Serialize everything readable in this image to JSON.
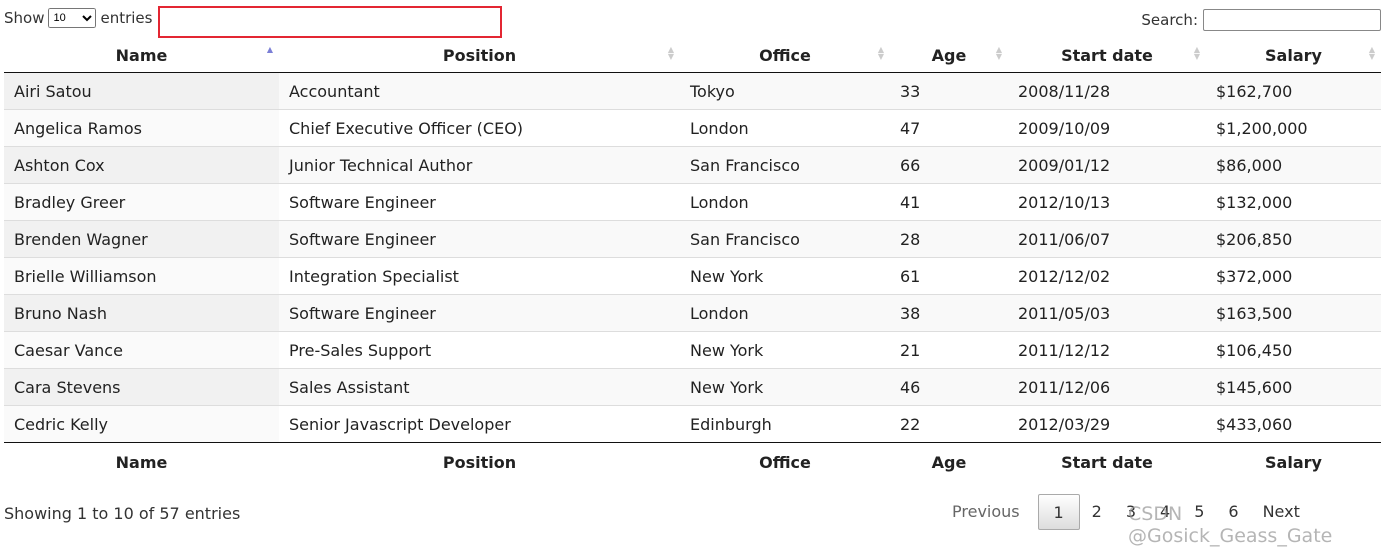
{
  "length": {
    "label_before": "Show",
    "value": "10",
    "label_after": "entries"
  },
  "search": {
    "label": "Search:",
    "value": ""
  },
  "columns": [
    "Name",
    "Position",
    "Office",
    "Age",
    "Start date",
    "Salary"
  ],
  "rows": [
    [
      "Airi Satou",
      "Accountant",
      "Tokyo",
      "33",
      "2008/11/28",
      "$162,700"
    ],
    [
      "Angelica Ramos",
      "Chief Executive Officer (CEO)",
      "London",
      "47",
      "2009/10/09",
      "$1,200,000"
    ],
    [
      "Ashton Cox",
      "Junior Technical Author",
      "San Francisco",
      "66",
      "2009/01/12",
      "$86,000"
    ],
    [
      "Bradley Greer",
      "Software Engineer",
      "London",
      "41",
      "2012/10/13",
      "$132,000"
    ],
    [
      "Brenden Wagner",
      "Software Engineer",
      "San Francisco",
      "28",
      "2011/06/07",
      "$206,850"
    ],
    [
      "Brielle Williamson",
      "Integration Specialist",
      "New York",
      "61",
      "2012/12/02",
      "$372,000"
    ],
    [
      "Bruno Nash",
      "Software Engineer",
      "London",
      "38",
      "2011/05/03",
      "$163,500"
    ],
    [
      "Caesar Vance",
      "Pre-Sales Support",
      "New York",
      "21",
      "2011/12/12",
      "$106,450"
    ],
    [
      "Cara Stevens",
      "Sales Assistant",
      "New York",
      "46",
      "2011/12/06",
      "$145,600"
    ],
    [
      "Cedric Kelly",
      "Senior Javascript Developer",
      "Edinburgh",
      "22",
      "2012/03/29",
      "$433,060"
    ]
  ],
  "sort": {
    "column": "Name",
    "direction": "ascending"
  },
  "info": "Showing 1 to 10 of 57 entries",
  "pagination": {
    "previous": "Previous",
    "pages": [
      "1",
      "2",
      "3",
      "4",
      "5",
      "6"
    ],
    "current": "1",
    "next": "Next"
  },
  "watermark": "CSDN @Gosick_Geass_Gate"
}
